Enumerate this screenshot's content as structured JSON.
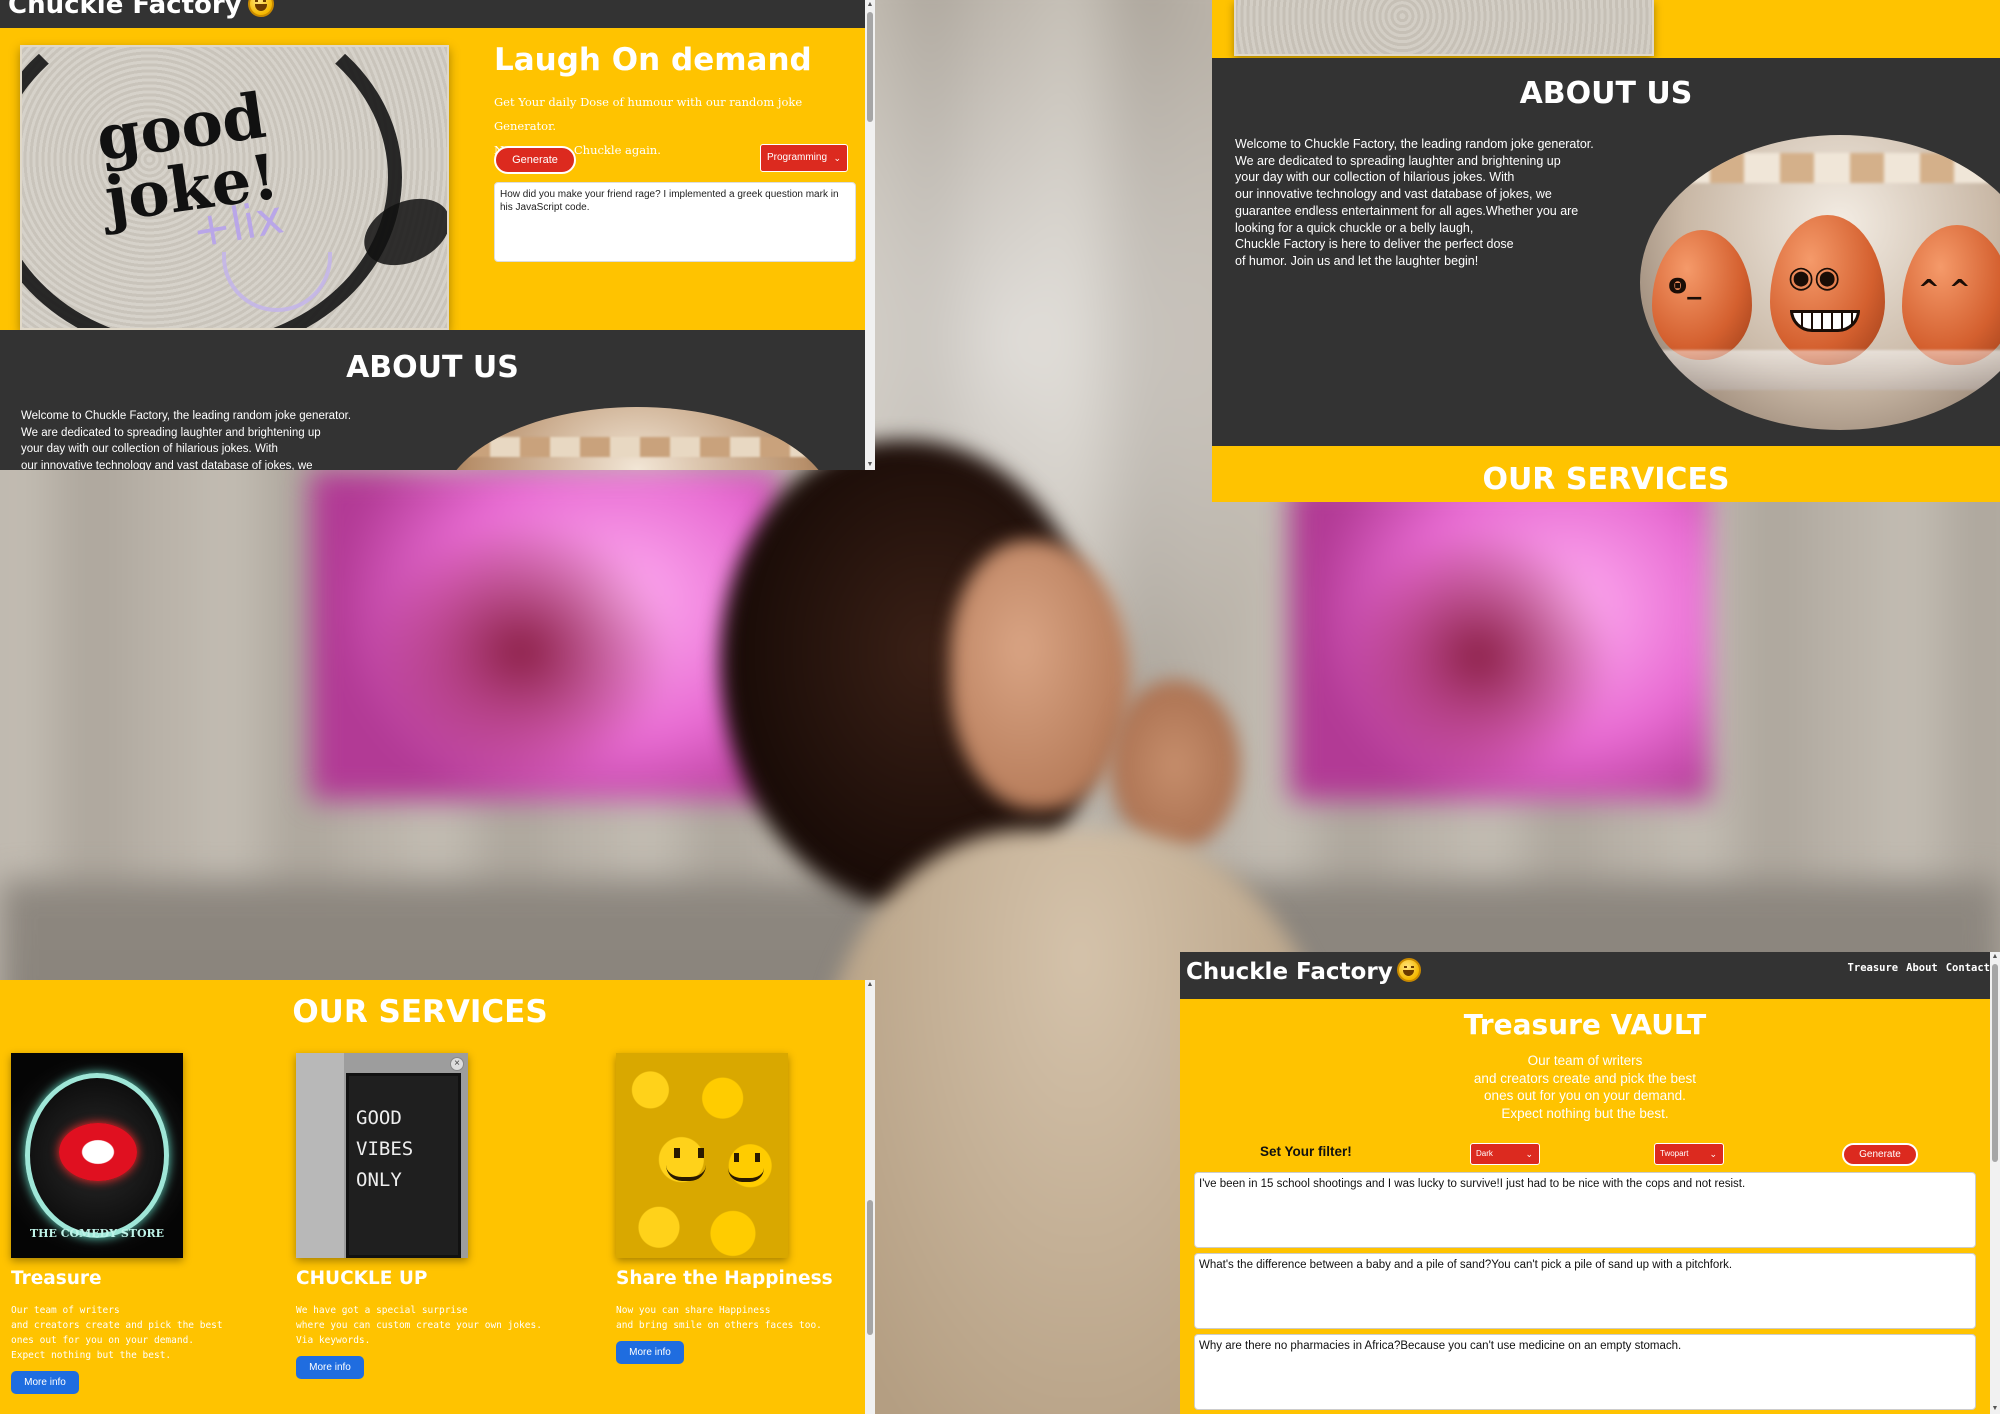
{
  "brand": {
    "name": "Chuckle Factory",
    "emoji_icon": "grinning-face-emoji"
  },
  "hero": {
    "title": "Laugh On demand",
    "subtitle_line1": "Get Your daily Dose of humour with our random joke Generator.",
    "subtitle_line2": "Never miss a Chuckle again.",
    "generate_label": "Generate",
    "category_selected": "Programming",
    "joke_text": "How did you make your friend rage? I implemented a greek question mark in his JavaScript code.",
    "image": {
      "graffiti_main": "good joke!",
      "graffiti_small": "+lix"
    }
  },
  "about": {
    "title": "ABOUT US",
    "lines": [
      "Welcome to Chuckle Factory, the leading random joke generator.",
      "We are dedicated to spreading laughter and brightening up",
      "your day with our collection of hilarious jokes. With",
      "our innovative technology and vast database of jokes, we",
      "guarantee endless entertainment for all ages.Whether you are",
      "looking for a quick chuckle or a belly laugh,",
      "Chuckle Factory is here to deliver the perfect dose",
      "of humor. Join us and let the laughter begin!"
    ]
  },
  "services": {
    "title": "OUR SERVICES",
    "cards": [
      {
        "title": "Treasure",
        "desc": "Our team of writers\nand creators create and pick the best\nones out for you on your demand.\nExpect nothing but the best.",
        "button": "More info",
        "image_icon": "comedy-store-neon-icon",
        "image_text": "THE COMEDY STORE"
      },
      {
        "title": "CHUCKLE UP",
        "desc": "We have got a special surprise\nwhere you can custom create your own jokes.\nVia keywords.",
        "button": "More info",
        "image_icon": "letter-board-icon",
        "image_text": "GOOD\nVIBES\nONLY"
      },
      {
        "title": "Share the Happiness",
        "desc": "Now you can share Happiness\nand bring smile on others faces too.",
        "button": "More info",
        "image_icon": "smiley-faces-icon"
      }
    ]
  },
  "vault": {
    "nav_links": [
      "Treasure",
      "About",
      "Contact"
    ],
    "title": "Treasure VAULT",
    "subtitle": "Our team of writers\nand creators create and pick the best\nones out for you on your demand.\nExpect nothing but the best.",
    "filter_label": "Set Your filter!",
    "filter_type": "Dark",
    "filter_format": "Twopart",
    "generate_label": "Generate",
    "jokes": [
      "I've been in 15 school shootings and I was lucky to survive!I just had to be nice with the cops and not resist.",
      "What's the difference between a baby and a pile of sand?You can't pick a pile of sand up with a pitchfork.",
      "Why are there no pharmacies in Africa?Because you can't use medicine on an empty stomach."
    ]
  },
  "colors": {
    "accent_yellow": "#ffc300",
    "dark_section": "#333333",
    "button_red": "#dc2a1f",
    "button_blue": "#1f6de0"
  }
}
